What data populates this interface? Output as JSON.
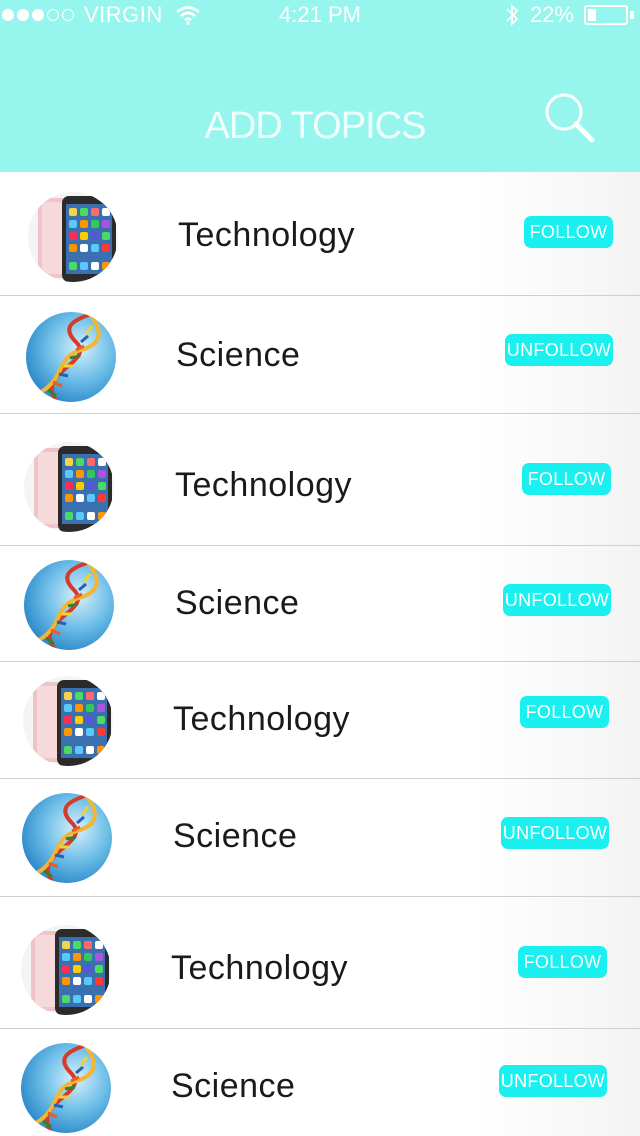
{
  "status_bar": {
    "carrier": "VIRGIN",
    "time": "4:21 PM",
    "battery": "22%",
    "battery_level": 0.22,
    "signal_bars": [
      true,
      true,
      true,
      false,
      false
    ]
  },
  "header": {
    "title": "ADD TOPICS",
    "search_icon": "search-icon"
  },
  "colors": {
    "header_bg": "#96f5ec",
    "button_bg": "#1af0f0"
  },
  "topics": [
    {
      "name": "Technology",
      "action": "FOLLOW",
      "image": "phone-image"
    },
    {
      "name": "Science",
      "action": "UNFOLLOW",
      "image": "dna-image"
    },
    {
      "name": "Technology",
      "action": "FOLLOW",
      "image": "phone-image"
    },
    {
      "name": "Science",
      "action": "UNFOLLOW",
      "image": "dna-image"
    },
    {
      "name": "Technology",
      "action": "FOLLOW",
      "image": "phone-image"
    },
    {
      "name": "Science",
      "action": "UNFOLLOW",
      "image": "dna-image"
    },
    {
      "name": "Technology",
      "action": "FOLLOW",
      "image": "phone-image"
    },
    {
      "name": "Science",
      "action": "UNFOLLOW",
      "image": "dna-image"
    }
  ]
}
